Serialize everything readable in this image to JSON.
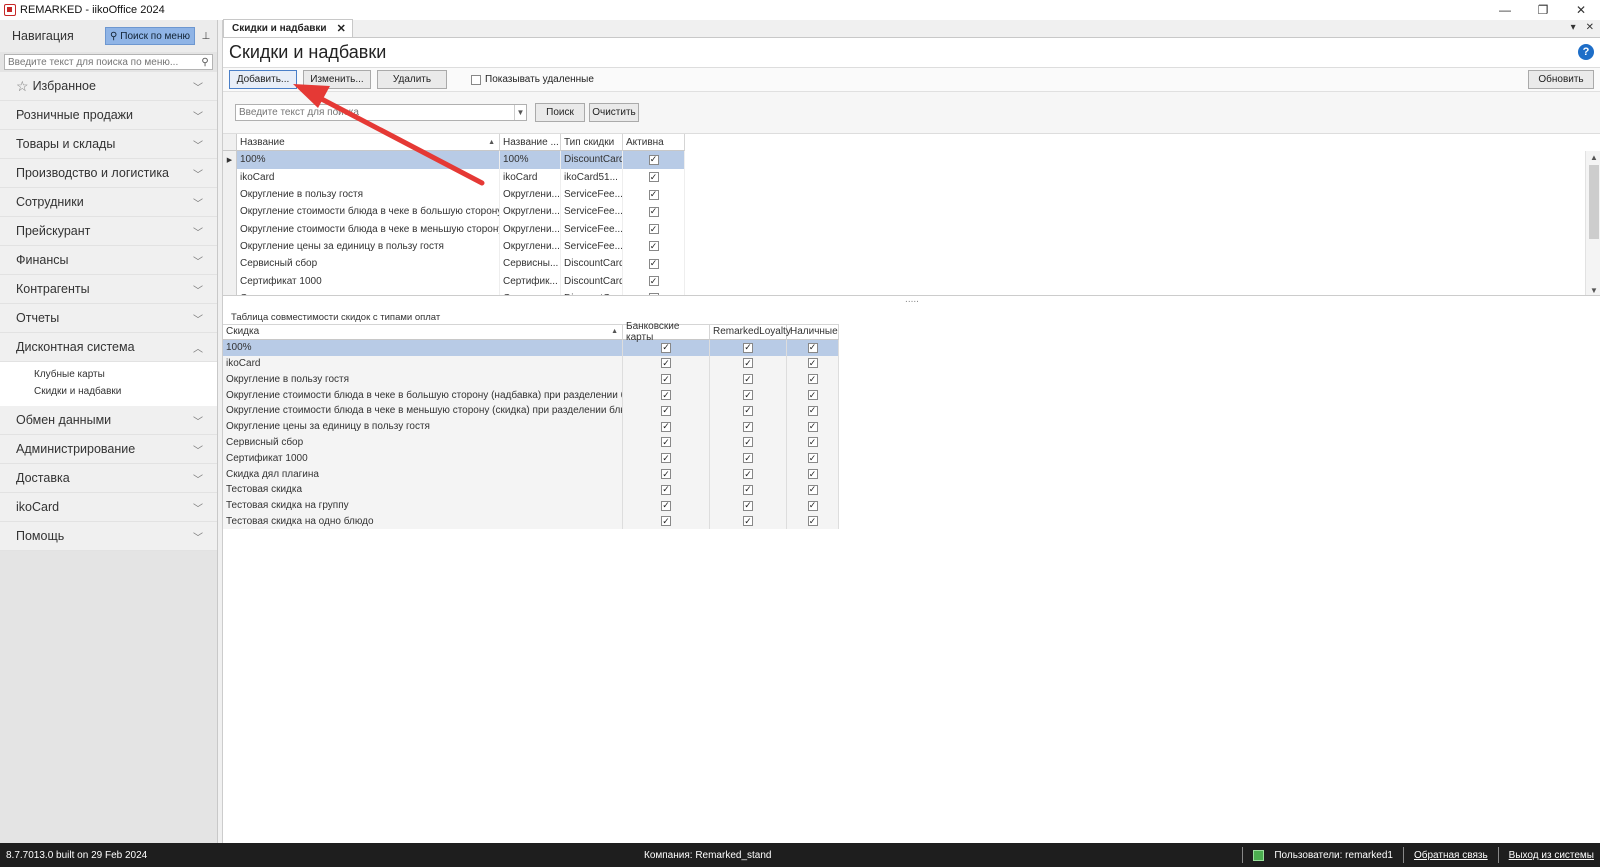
{
  "window": {
    "title": "REMARKED - iikoOffice 2024",
    "controls": [
      "—",
      "❐",
      "✕"
    ]
  },
  "nav": {
    "title": "Навигация",
    "menu_search_label": "Поиск по меню",
    "search_placeholder": "Введите текст для поиска по меню...",
    "items": [
      {
        "label": "Избранное"
      },
      {
        "label": "Розничные продажи"
      },
      {
        "label": "Товары и склады"
      },
      {
        "label": "Производство и логистика"
      },
      {
        "label": "Сотрудники"
      },
      {
        "label": "Прейскурант"
      },
      {
        "label": "Финансы"
      },
      {
        "label": "Контрагенты"
      },
      {
        "label": "Отчеты"
      },
      {
        "label": "Дисконтная система"
      },
      {
        "label": "Обмен данными"
      },
      {
        "label": "Администрирование"
      },
      {
        "label": "Доставка"
      },
      {
        "label": "ikoCard"
      },
      {
        "label": "Помощь"
      }
    ],
    "discount_sub": [
      "Клубные карты",
      "Скидки и надбавки"
    ]
  },
  "tab": {
    "label": "Скидки и надбавки"
  },
  "page": {
    "title": "Скидки и надбавки",
    "help": "?"
  },
  "toolbar": {
    "add": "Добавить...",
    "edit": "Изменить...",
    "delete": "Удалить",
    "show_deleted": "Показывать удаленные",
    "refresh": "Обновить"
  },
  "search": {
    "placeholder": "Введите текст для поиска",
    "search_btn": "Поиск",
    "clear_btn": "Очистить"
  },
  "grid1": {
    "headers": [
      "Название",
      "Название ...",
      "Тип скидки",
      "Активна"
    ],
    "rows": [
      {
        "name": "100%",
        "name2": "100%",
        "type": "DiscountCard",
        "active": "✓"
      },
      {
        "name": "ikoCard",
        "name2": "ikoCard",
        "type": "ikoCard51...",
        "active": "✓"
      },
      {
        "name": "Округление в пользу гостя",
        "name2": "Округлени...",
        "type": "ServiceFee...",
        "active": "✓"
      },
      {
        "name": "Округление стоимости блюда в чеке в большую сторону (...",
        "name2": "Округлени...",
        "type": "ServiceFee...",
        "active": "✓"
      },
      {
        "name": "Округление стоимости блюда в чеке в меньшую сторону (...",
        "name2": "Округлени...",
        "type": "ServiceFee...",
        "active": "✓"
      },
      {
        "name": "Округление цены за единицу в пользу гостя",
        "name2": "Округлени...",
        "type": "ServiceFee...",
        "active": "✓"
      },
      {
        "name": "Сервисный сбор",
        "name2": "Сервисны...",
        "type": "DiscountCard",
        "active": "✓"
      },
      {
        "name": "Сертификат 1000",
        "name2": "Сертифик...",
        "type": "DiscountCard",
        "active": "✓"
      },
      {
        "name": "Скидка дял плагина",
        "name2": "Скидка дл...",
        "type": "DiscountCard",
        "active": "✓"
      }
    ]
  },
  "splitter": ".....",
  "grid2": {
    "title": "Таблица совместимости скидок с типами оплат",
    "headers": [
      "Скидка",
      "Банковские карты",
      "RemarkedLoyalty",
      "Наличные"
    ],
    "rows": [
      {
        "name": "100%",
        "bank": "✓",
        "rl": "✓",
        "cash": "✓"
      },
      {
        "name": "ikoCard",
        "bank": "✓",
        "rl": "✓",
        "cash": "✓"
      },
      {
        "name": "Округление в пользу гостя",
        "bank": "✓",
        "rl": "✓",
        "cash": "✓"
      },
      {
        "name": "Округление стоимости блюда в чеке в большую сторону (надбавка) при разделении блюда",
        "bank": "✓",
        "rl": "✓",
        "cash": "✓"
      },
      {
        "name": "Округление стоимости блюда в чеке в меньшую сторону (скидка) при разделении блюда",
        "bank": "✓",
        "rl": "✓",
        "cash": "✓"
      },
      {
        "name": "Округление цены за единицу в пользу гостя",
        "bank": "✓",
        "rl": "✓",
        "cash": "✓"
      },
      {
        "name": "Сервисный сбор",
        "bank": "✓",
        "rl": "✓",
        "cash": "✓"
      },
      {
        "name": "Сертификат 1000",
        "bank": "✓",
        "rl": "✓",
        "cash": "✓"
      },
      {
        "name": "Скидка дял плагина",
        "bank": "✓",
        "rl": "✓",
        "cash": "✓"
      },
      {
        "name": "Тестовая скидка",
        "bank": "✓",
        "rl": "✓",
        "cash": "✓"
      },
      {
        "name": "Тестовая скидка на группу",
        "bank": "✓",
        "rl": "✓",
        "cash": "✓"
      },
      {
        "name": "Тестовая скидка на одно блюдо",
        "bank": "✓",
        "rl": "✓",
        "cash": "✓"
      }
    ]
  },
  "status": {
    "version": "8.7.7013.0 built on 29 Feb 2024",
    "company": "Компания: Remarked_stand",
    "users": "Пользователи: remarked1",
    "feedback": "Обратная связь",
    "logout": "Выход из системы"
  },
  "colors": {
    "selection": "#b8cbe6",
    "accent": "#1e6ec8",
    "annotation_arrow": "#e53935"
  }
}
